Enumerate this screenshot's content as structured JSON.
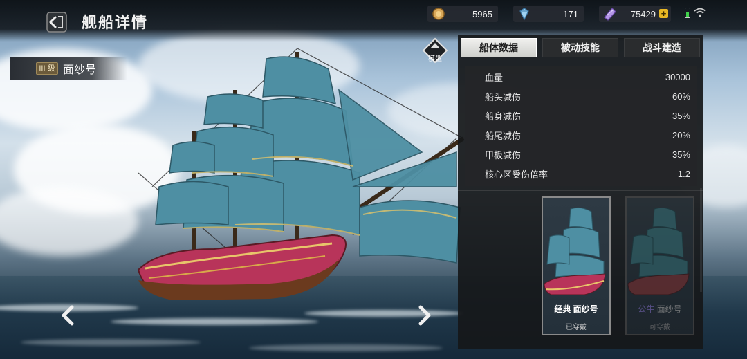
{
  "header": {
    "title": "舰船详情",
    "resources": [
      {
        "icon": "coin-icon",
        "value": "5965"
      },
      {
        "icon": "diamond-icon",
        "value": "171"
      },
      {
        "icon": "crystal-icon",
        "value": "75429",
        "has_plus": true
      }
    ]
  },
  "ship": {
    "grade": "III 级",
    "name": "面纱号"
  },
  "model_button": {
    "label": "模型"
  },
  "tabs": [
    {
      "label": "船体数据",
      "active": true
    },
    {
      "label": "被动技能",
      "active": false
    },
    {
      "label": "战斗建造",
      "active": false
    }
  ],
  "stats": [
    {
      "label": "血量",
      "value": "30000"
    },
    {
      "label": "船头减伤",
      "value": "60%"
    },
    {
      "label": "船身减伤",
      "value": "35%"
    },
    {
      "label": "船尾减伤",
      "value": "20%"
    },
    {
      "label": "甲板减伤",
      "value": "35%"
    },
    {
      "label": "核心区受伤倍率",
      "value": "1.2"
    }
  ],
  "skins": [
    {
      "prefix": "经典",
      "name": "面纱号",
      "status": "已穿戴",
      "selected": true
    },
    {
      "prefix": "公牛",
      "name": "面纱号",
      "status": "可穿戴",
      "selected": false
    }
  ],
  "colors": {
    "accent_gold": "#e8b824",
    "skin_highlight": "#8b7ad8",
    "battery_green": "#3fd14a"
  }
}
